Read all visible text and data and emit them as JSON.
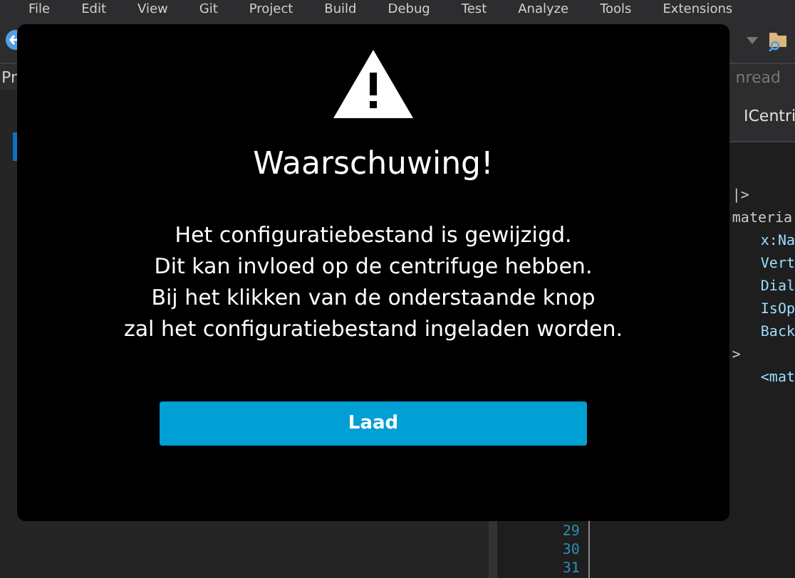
{
  "menu_bar": {
    "items": [
      "File",
      "Edit",
      "View",
      "Git",
      "Project",
      "Build",
      "Debug",
      "Test",
      "Analyze",
      "Tools",
      "Extensions"
    ]
  },
  "toolbar": {
    "search_hint": "nread"
  },
  "tabs": {
    "left_tab": "Pr",
    "editor_tab": "ICentri"
  },
  "editor": {
    "code_lines": [
      {
        "text": "|>",
        "kind": "outer"
      },
      {
        "text": "materia",
        "kind": "outer"
      },
      {
        "text": "x:Na",
        "kind": "inner"
      },
      {
        "text": "Vert",
        "kind": "inner"
      },
      {
        "text": "Dial",
        "kind": "inner"
      },
      {
        "text": "IsOp",
        "kind": "inner"
      },
      {
        "text": "Back",
        "kind": "inner"
      },
      {
        "text": ">",
        "kind": "outer"
      },
      {
        "text": "<mat",
        "kind": "inner"
      }
    ],
    "line_numbers": [
      "29",
      "30",
      "31"
    ]
  },
  "dialog": {
    "title": "Waarschuwing!",
    "message": [
      "Het configuratiebestand is gewijzigd.",
      "Dit kan invloed op de centrifuge hebben.",
      "Bij het klikken van de onderstaande knop",
      "zal het configuratiebestand ingeladen worden."
    ],
    "button": "Laad"
  }
}
